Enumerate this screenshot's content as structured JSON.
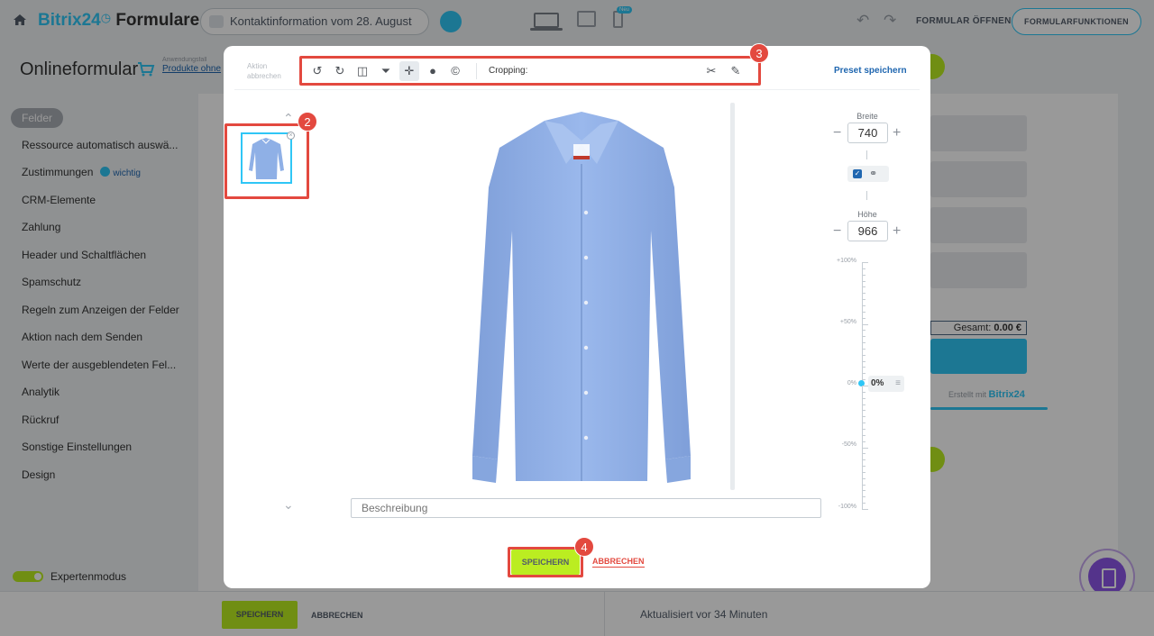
{
  "app": {
    "brand_main": "Bitrix24",
    "brand_suffix": "Formulare",
    "form_title": "Kontaktinformation vom 28. August",
    "device_new_badge": "Neu",
    "open_form_label": "FORMULAR ÖFFNEN",
    "form_functions_label": "FORMULARFUNKTIONEN"
  },
  "page": {
    "title": "Onlineformular",
    "usecase_label": "Anwendungsfall",
    "usecase_link": "Produkte ohne"
  },
  "sidebar": {
    "active": "Felder",
    "items": [
      {
        "label": "Ressource automatisch auswä..."
      },
      {
        "label": "Zustimmungen",
        "badge": "wichtig"
      },
      {
        "label": "CRM-Elemente"
      },
      {
        "label": "Zahlung"
      },
      {
        "label": "Header und Schaltflächen"
      },
      {
        "label": "Spamschutz"
      },
      {
        "label": "Regeln zum Anzeigen der Felder"
      },
      {
        "label": "Aktion nach dem Senden"
      },
      {
        "label": "Werte der ausgeblendeten Fel..."
      },
      {
        "label": "Analytik"
      },
      {
        "label": "Rückruf"
      },
      {
        "label": "Sonstige Einstellungen"
      },
      {
        "label": "Design"
      }
    ],
    "expert_mode_label": "Expertenmodus"
  },
  "preview_panel": {
    "total_label": "Gesamt:",
    "total_value": "0.00 €",
    "created_with": "Erstellt mit",
    "created_brand": "Bitrix24"
  },
  "bottom_bar": {
    "save_label": "SPEICHERN",
    "cancel_label": "ABBRECHEN",
    "updated_text": "Aktualisiert vor 34 Minuten"
  },
  "editor": {
    "action_cancel_label": "Aktion abbrechen",
    "toolbar": {
      "tools": [
        {
          "icon": "rotate-left-icon"
        },
        {
          "icon": "rotate-right-icon"
        },
        {
          "icon": "flip-horizontal-icon"
        },
        {
          "icon": "flip-vertical-icon"
        },
        {
          "icon": "crop-icon",
          "active": true
        },
        {
          "icon": "filter-icon"
        },
        {
          "icon": "copyright-icon"
        }
      ],
      "mode_label": "Cropping:",
      "scissors_icon": "scissors-icon",
      "pen_icon": "pen-icon"
    },
    "preset_save_label": "Preset speichern",
    "description_placeholder": "Beschreibung",
    "width_label": "Breite",
    "width_value": "740",
    "height_label": "Höhe",
    "height_value": "966",
    "keep_ratio_checked": true,
    "scale": {
      "labels": [
        "+100%",
        "+50%",
        "0%",
        "-50%",
        "-100%"
      ],
      "current": "0%"
    },
    "save_label": "SPEICHERN",
    "cancel_label": "ABBRECHEN"
  },
  "annotations": {
    "step_thumb": "2",
    "step_toolbar": "3",
    "step_save": "4"
  },
  "colors": {
    "accent_blue": "#2fc6f6",
    "save_green": "#bbed21",
    "annotation_red": "#e3493f",
    "shirt_blue": "#8fb0e6"
  }
}
